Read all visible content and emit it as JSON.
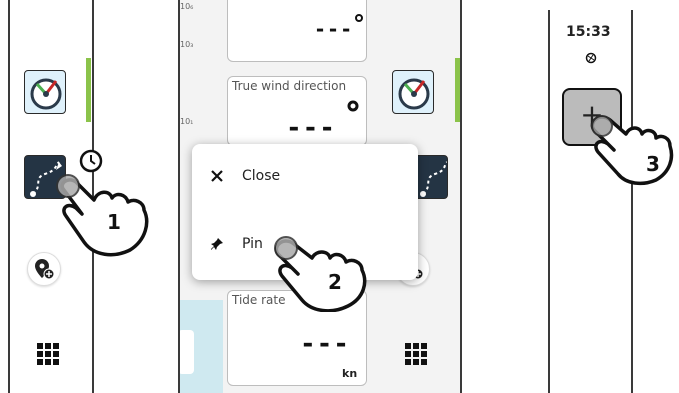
{
  "panel2": {
    "scale_labels": [
      "10₆",
      "10₃",
      "10₁"
    ],
    "true_wind": {
      "label": "True wind direction",
      "value": "---"
    },
    "top_box": {
      "value": "---"
    },
    "tide_rate": {
      "label": "Tide rate",
      "value": "---",
      "unit": "kn"
    },
    "popup": {
      "close_label": "Close",
      "pin_label": "Pin"
    }
  },
  "panel3": {
    "time": "15:33",
    "add_symbol": "+"
  },
  "steps": [
    "1",
    "2",
    "3"
  ],
  "colors": {
    "accent_green": "#8bc34a",
    "border": "#2a2a2a"
  }
}
